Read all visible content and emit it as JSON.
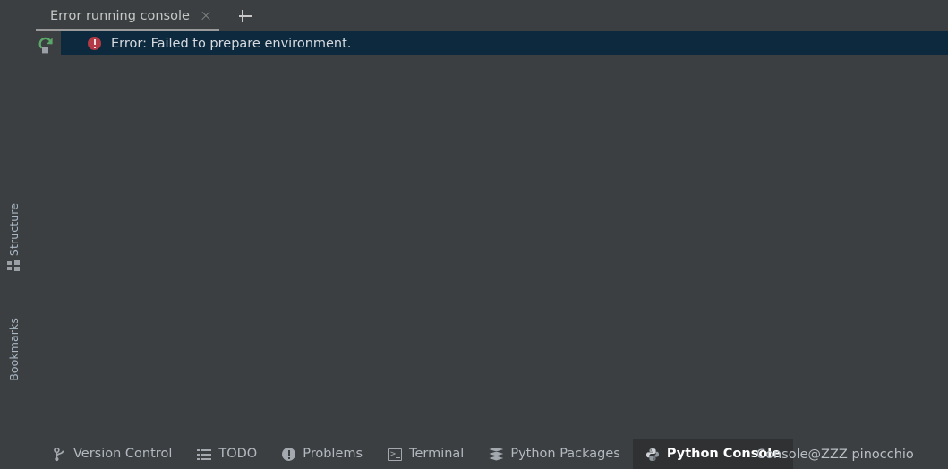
{
  "window": {
    "background_color": "#3c3f41",
    "selection_color": "#0d293e",
    "accent_error_color": "#b13a46",
    "accent_run_color": "#59a869"
  },
  "left_tool_strip": {
    "items": [
      {
        "label": "Structure",
        "icon": "structure-icon"
      },
      {
        "label": "Bookmarks",
        "icon": "bookmark-icon"
      }
    ]
  },
  "console_panel": {
    "tabs": [
      {
        "label": "Error running console",
        "close_icon": "close-icon",
        "active": true
      }
    ],
    "add_tab_icon": "plus-icon",
    "gutter": {
      "rerun_icon": "rerun-icon"
    },
    "output": {
      "lines": [
        {
          "icon": "error-icon",
          "text": "Error: Failed to prepare environment.",
          "selected": true
        }
      ]
    }
  },
  "status_bar": {
    "items": [
      {
        "label": "Version Control",
        "icon": "branch-icon",
        "active": false
      },
      {
        "label": "TODO",
        "icon": "todo-list-icon",
        "active": false
      },
      {
        "label": "Problems",
        "icon": "problems-icon",
        "active": false
      },
      {
        "label": "Terminal",
        "icon": "terminal-icon",
        "active": false
      },
      {
        "label": "Python Packages",
        "icon": "layers-icon",
        "active": false
      },
      {
        "label": "Python Console",
        "icon": "python-icon",
        "active": true
      }
    ],
    "overlay_label": "Console@ZZZ pinocchio"
  }
}
